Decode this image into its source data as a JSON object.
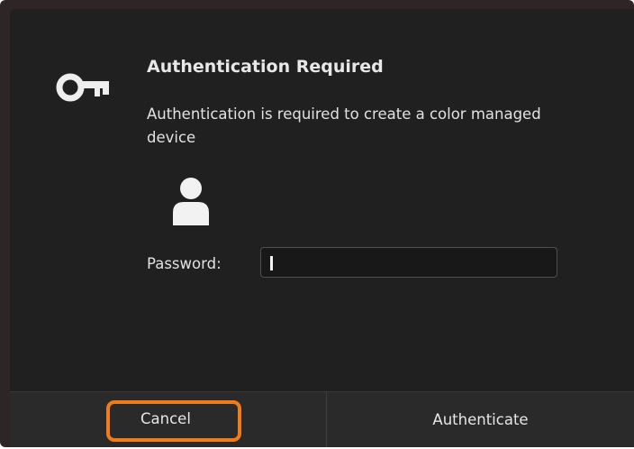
{
  "dialog": {
    "title": "Authentication Required",
    "message": "Authentication is required to create a color managed device",
    "password_label": "Password:",
    "password_value": "",
    "buttons": {
      "cancel": "Cancel",
      "authenticate": "Authenticate"
    }
  },
  "icons": {
    "dialog_icon": "key-icon",
    "user_icon": "user-avatar-icon"
  },
  "colors": {
    "dialog_background": "#202020",
    "text": "#e2e2e2",
    "highlight": "#f07b1a"
  }
}
